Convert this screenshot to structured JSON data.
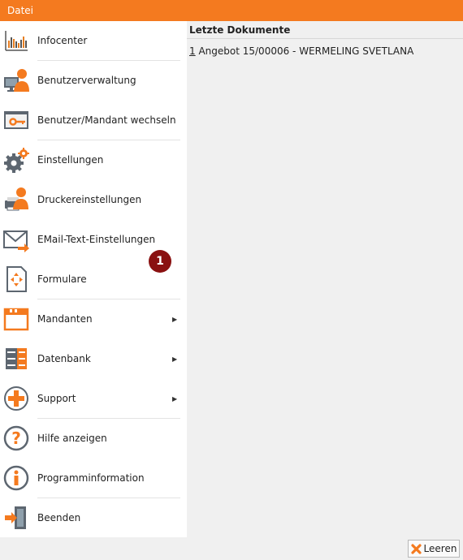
{
  "menu_bar": {
    "file_tab": "Datei"
  },
  "sidebar": {
    "items": [
      {
        "label": "Infocenter"
      },
      {
        "label": "Benutzerverwaltung"
      },
      {
        "label": "Benutzer/Mandant wechseln"
      },
      {
        "label": "Einstellungen"
      },
      {
        "label": "Druckereinstellungen"
      },
      {
        "label": "EMail-Text-Einstellungen"
      },
      {
        "label": "Formulare"
      },
      {
        "label": "Mandanten"
      },
      {
        "label": "Datenbank"
      },
      {
        "label": "Support"
      },
      {
        "label": "Hilfe anzeigen"
      },
      {
        "label": "Programminformation"
      },
      {
        "label": "Beenden"
      }
    ],
    "callout_number": "1"
  },
  "recent": {
    "header": "Letzte Dokumente",
    "documents": [
      {
        "number": "1",
        "title": " Angebot 15/00006 - WERMELING SVETLANA"
      }
    ]
  },
  "footer": {
    "clear_label": "Leeren"
  },
  "colors": {
    "accent": "#f47a1f",
    "callout": "#8a1111",
    "panel": "#f0f0f0"
  }
}
